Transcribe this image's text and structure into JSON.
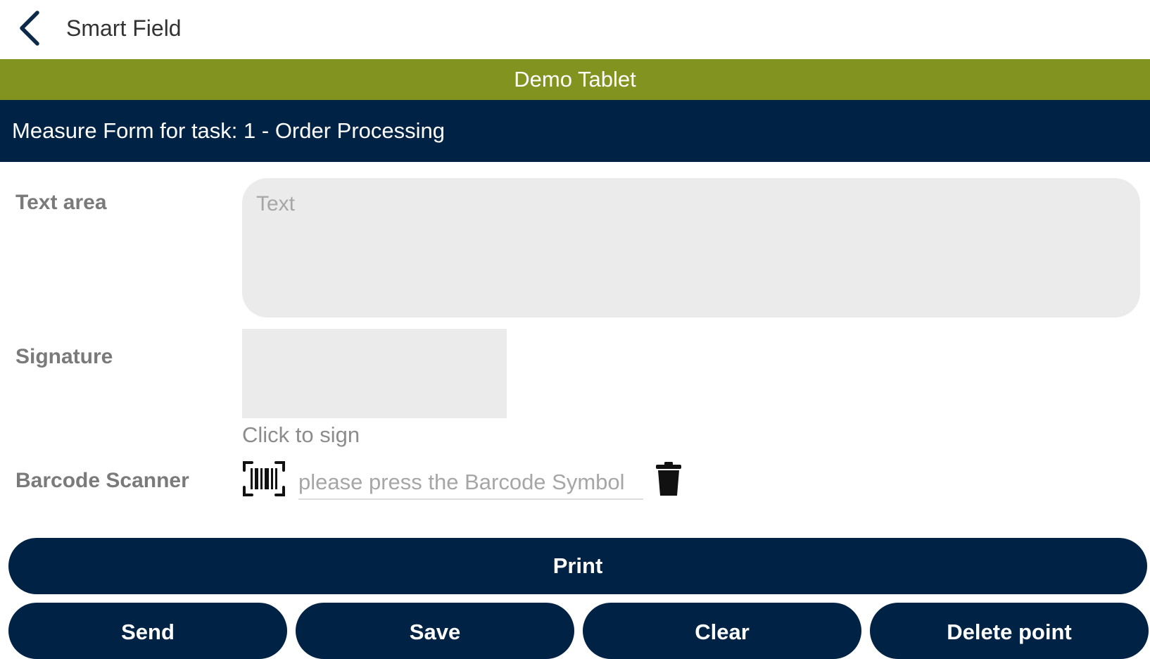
{
  "app_bar": {
    "title": "Smart Field",
    "back_icon": "chevron-left-icon"
  },
  "device_banner": {
    "label": "Demo Tablet",
    "color": "#829320"
  },
  "form_header": {
    "title": "Measure Form for task: 1 - Order Processing",
    "color": "#002345"
  },
  "fields": {
    "text_area": {
      "label": "Text area",
      "placeholder": "Text",
      "value": ""
    },
    "signature": {
      "label": "Signature",
      "hint": "Click to sign"
    },
    "barcode": {
      "label": "Barcode Scanner",
      "placeholder": "please press the Barcode Symbol",
      "value": "",
      "scan_icon": "barcode-icon",
      "delete_icon": "trash-icon"
    }
  },
  "actions": {
    "print": "Print",
    "send": "Send",
    "save": "Save",
    "clear": "Clear",
    "delete_point": "Delete point"
  },
  "colors": {
    "primary": "#002345",
    "accent": "#829320",
    "field_bg": "#ebebeb"
  }
}
